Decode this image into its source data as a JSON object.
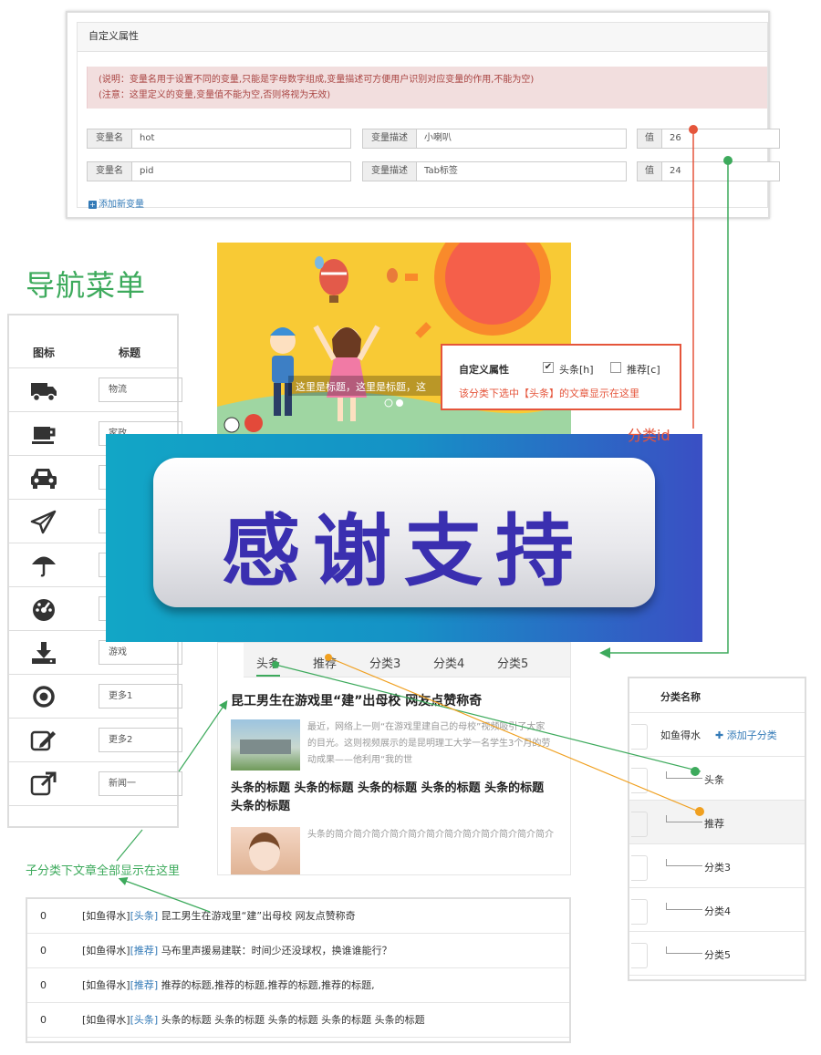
{
  "attr_panel": {
    "title": "自定义属性",
    "note_line1": "(说明：变量名用于设置不同的变量,只能是字母数字组成,变量描述可方便用户识别对应变量的作用,不能为空)",
    "note_line2": "(注意：这里定义的变量,变量值不能为空,否则将视为无效)",
    "name_label": "变量名",
    "desc_label": "变量描述",
    "value_label": "值",
    "rows": [
      {
        "name": "hot",
        "desc": "小喇叭",
        "value": "26"
      },
      {
        "name": "pid",
        "desc": "Tab标签",
        "value": "24"
      }
    ],
    "add_label": "添加新变量"
  },
  "nav_menu": {
    "title": "导航菜单",
    "col_icon": "图标",
    "col_title": "标题",
    "items": [
      {
        "icon": "truck-icon",
        "label": "物流"
      },
      {
        "icon": "cup-icon",
        "label": "家政"
      },
      {
        "icon": "taxi-icon",
        "label": ""
      },
      {
        "icon": "paper-plane-icon",
        "label": ""
      },
      {
        "icon": "umbrella-icon",
        "label": ""
      },
      {
        "icon": "dashboard-icon",
        "label": ""
      },
      {
        "icon": "download-icon",
        "label": "游戏"
      },
      {
        "icon": "dot-circle-icon",
        "label": "更多1"
      },
      {
        "icon": "edit-icon",
        "label": "更多2"
      },
      {
        "icon": "external-link-icon",
        "label": "新闻一"
      }
    ]
  },
  "banner": {
    "caption": "这里是标题，这里是标题，这"
  },
  "custom_attr_box": {
    "label": "自定义属性",
    "option1": "头条[h]",
    "option1_checked": true,
    "option2": "推荐[c]",
    "option2_checked": false,
    "hint": "该分类下选中【头条】的文章显示在这里"
  },
  "category_id_label": "分类id",
  "thanks": {
    "text": "感谢支持"
  },
  "articles": {
    "tabs": [
      "头条",
      "推荐",
      "分类3",
      "分类4",
      "分类5"
    ],
    "active_tab": 0,
    "item1_title": "昆工男生在游戏里“建”出母校 网友点赞称奇",
    "item1_desc": "最近，网络上一则“在游戏里建自己的母校”视频吸引了大家的目光。这则视频展示的是昆明理工大学一名学生3个月的劳动成果——他利用“我的世",
    "item2_title": "头条的标题 头条的标题 头条的标题 头条的标题 头条的标题 头条的标题",
    "item2_desc": "头条的简介简介简介简介简介简介简介简介简介简介简介简介"
  },
  "category_panel": {
    "header": "分类名称",
    "root": "如鱼得水",
    "add_child": "添加子分类",
    "children": [
      "头条",
      "推荐",
      "分类3",
      "分类4",
      "分类5"
    ]
  },
  "sub_label": "子分类下文章全部显示在这里",
  "list": {
    "rows": [
      {
        "num": "0",
        "cat": "[如鱼得水]",
        "tag": "[头条]",
        "title": "昆工男生在游戏里“建”出母校 网友点赞称奇"
      },
      {
        "num": "0",
        "cat": "[如鱼得水]",
        "tag": "[推荐]",
        "title": "马布里声援易建联：时间少还没球权，换谁谁能行？"
      },
      {
        "num": "0",
        "cat": "[如鱼得水]",
        "tag": "[推荐]",
        "title": "推荐的标题,推荐的标题,推荐的标题,推荐的标题,"
      },
      {
        "num": "0",
        "cat": "[如鱼得水]",
        "tag": "[头条]",
        "title": "头条的标题 头条的标题 头条的标题 头条的标题 头条的标题"
      }
    ]
  },
  "colors": {
    "green": "#3daa5c",
    "orange": "#e5553b",
    "amber": "#f0a020",
    "blue": "#337ab7"
  }
}
